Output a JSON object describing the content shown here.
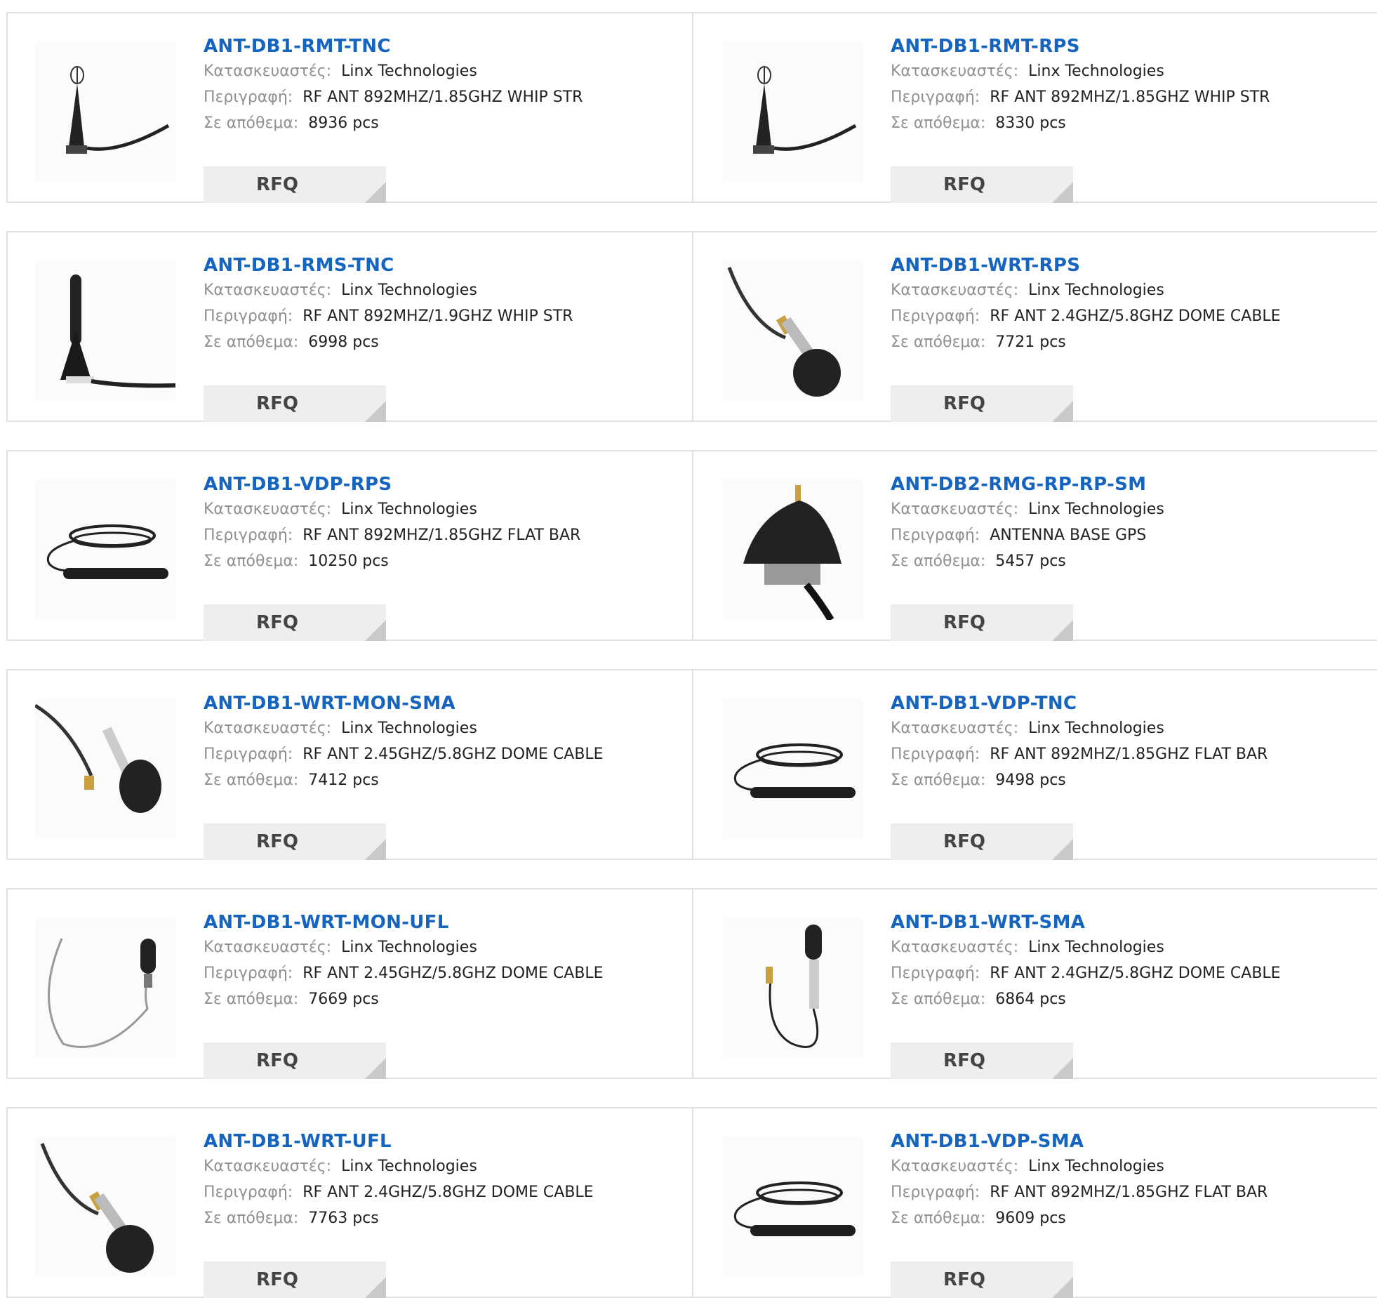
{
  "labels": {
    "manufacturer": "Κατασκευαστές:",
    "description": "Περιγραφή:",
    "stock": "Σε απόθεμα:",
    "rfq": "RFQ"
  },
  "products": [
    {
      "part": "ANT-DB1-RMT-TNC",
      "manufacturer": "Linx Technologies",
      "description": "RF ANT 892MHZ/1.85GHZ WHIP STR",
      "stock": "8936 pcs",
      "image_icon": "whip-antenna-icon"
    },
    {
      "part": "ANT-DB1-RMT-RPS",
      "manufacturer": "Linx Technologies",
      "description": "RF ANT 892MHZ/1.85GHZ WHIP STR",
      "stock": "8330 pcs",
      "image_icon": "whip-antenna-icon"
    },
    {
      "part": "ANT-DB1-RMS-TNC",
      "manufacturer": "Linx Technologies",
      "description": "RF ANT 892MHZ/1.9GHZ WHIP STR",
      "stock": "6998 pcs",
      "image_icon": "stubby-antenna-icon"
    },
    {
      "part": "ANT-DB1-WRT-RPS",
      "manufacturer": "Linx Technologies",
      "description": "RF ANT 2.4GHZ/5.8GHZ DOME CABLE",
      "stock": "7721 pcs",
      "image_icon": "dome-antenna-icon"
    },
    {
      "part": "ANT-DB1-VDP-RPS",
      "manufacturer": "Linx Technologies",
      "description": "RF ANT 892MHZ/1.85GHZ FLAT BAR",
      "stock": "10250 pcs",
      "image_icon": "flat-bar-antenna-icon"
    },
    {
      "part": "ANT-DB2-RMG-RP-RP-SM",
      "manufacturer": "Linx Technologies",
      "description": "ANTENNA BASE GPS",
      "stock": "5457 pcs",
      "image_icon": "shark-fin-antenna-icon"
    },
    {
      "part": "ANT-DB1-WRT-MON-SMA",
      "manufacturer": "Linx Technologies",
      "description": "RF ANT 2.45GHZ/5.8GHZ DOME CABLE",
      "stock": "7412 pcs",
      "image_icon": "dome-cable-antenna-icon"
    },
    {
      "part": "ANT-DB1-VDP-TNC",
      "manufacturer": "Linx Technologies",
      "description": "RF ANT 892MHZ/1.85GHZ FLAT BAR",
      "stock": "9498 pcs",
      "image_icon": "flat-bar-antenna-icon"
    },
    {
      "part": "ANT-DB1-WRT-MON-UFL",
      "manufacturer": "Linx Technologies",
      "description": "RF ANT 2.45GHZ/5.8GHZ DOME CABLE",
      "stock": "7669 pcs",
      "image_icon": "ufl-dome-antenna-icon"
    },
    {
      "part": "ANT-DB1-WRT-SMA",
      "manufacturer": "Linx Technologies",
      "description": "RF ANT 2.4GHZ/5.8GHZ DOME CABLE",
      "stock": "6864 pcs",
      "image_icon": "sma-dome-antenna-icon"
    },
    {
      "part": "ANT-DB1-WRT-UFL",
      "manufacturer": "Linx Technologies",
      "description": "RF ANT 2.4GHZ/5.8GHZ DOME CABLE",
      "stock": "7763 pcs",
      "image_icon": "dome-antenna-icon"
    },
    {
      "part": "ANT-DB1-VDP-SMA",
      "manufacturer": "Linx Technologies",
      "description": "RF ANT 892MHZ/1.85GHZ FLAT BAR",
      "stock": "9609 pcs",
      "image_icon": "flat-bar-antenna-icon"
    }
  ]
}
